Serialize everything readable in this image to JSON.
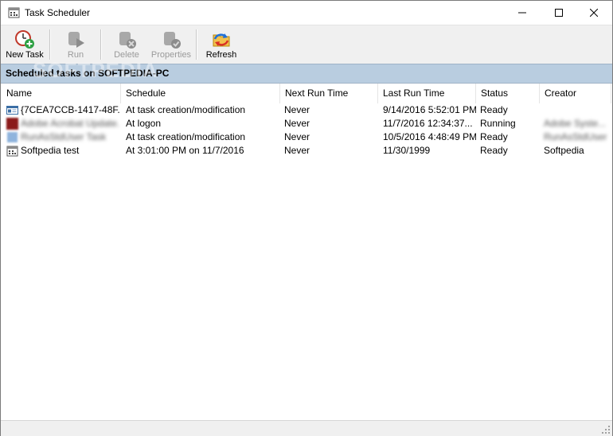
{
  "window": {
    "title": "Task Scheduler"
  },
  "toolbar": {
    "buttons": [
      {
        "label": "New Task",
        "icon": "new-task-icon",
        "enabled": true
      },
      {
        "label": "Run",
        "icon": "run-icon",
        "enabled": false
      },
      {
        "label": "Delete",
        "icon": "delete-icon",
        "enabled": false
      },
      {
        "label": "Properties",
        "icon": "properties-icon",
        "enabled": false
      },
      {
        "label": "Refresh",
        "icon": "refresh-icon",
        "enabled": true
      }
    ]
  },
  "section": {
    "title": "Scheduled tasks on SOFTPEDIA-PC",
    "watermark": "SOFTPEDIA"
  },
  "columns": [
    "Name",
    "Schedule",
    "Next Run Time",
    "Last Run Time",
    "Status",
    "Creator"
  ],
  "tasks": [
    {
      "name": "{7CEA7CCB-1417-48F...",
      "schedule": "At task creation/modification",
      "next_run": "Never",
      "last_run": "9/14/2016 5:52:01 PM",
      "status": "Ready",
      "creator": "",
      "icon": "task-window-icon"
    },
    {
      "name": "Adobe Acrobat Update...",
      "schedule": "At logon",
      "next_run": "Never",
      "last_run": "11/7/2016 12:34:37...",
      "status": "Running",
      "creator": "Adobe Syste...",
      "icon": "adobe-icon"
    },
    {
      "name": "RunAsStdUser Task",
      "schedule": "At task creation/modification",
      "next_run": "Never",
      "last_run": "10/5/2016 4:48:49 PM",
      "status": "Ready",
      "creator": "RunAsStdUser",
      "icon": "task-icon"
    },
    {
      "name": "Softpedia test",
      "schedule": "At 3:01:00 PM on 11/7/2016",
      "next_run": "Never",
      "last_run": "11/30/1999",
      "status": "Ready",
      "creator": "Softpedia",
      "icon": "scheduler-icon"
    }
  ],
  "colors": {
    "header_band": "#b9cde0",
    "toolbar_bg": "#f0f0f0"
  }
}
